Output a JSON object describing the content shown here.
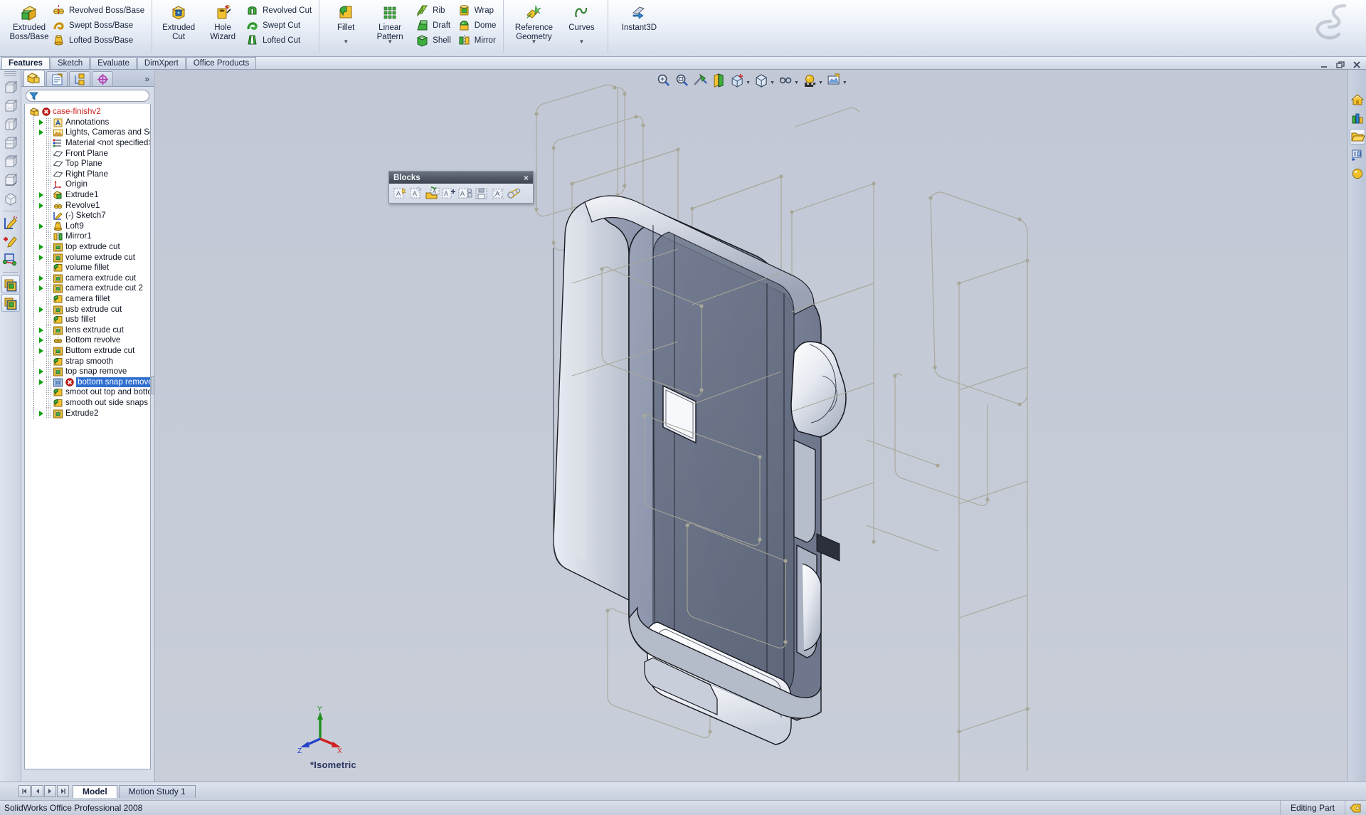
{
  "app": {
    "title": "SolidWorks Office Professional 2008",
    "status_right": "Editing Part"
  },
  "ribbon": {
    "groups": [
      {
        "big": {
          "label": "Extruded\nBoss/Base",
          "icon": "extruded-boss-base-icon"
        },
        "small": [
          {
            "label": "Revolved Boss/Base",
            "icon": "revolved-boss-base-icon"
          },
          {
            "label": "Swept Boss/Base",
            "icon": "swept-boss-base-icon"
          },
          {
            "label": "Lofted Boss/Base",
            "icon": "lofted-boss-base-icon"
          }
        ]
      },
      {
        "big2": [
          {
            "label": "Extruded\nCut",
            "icon": "extruded-cut-icon"
          },
          {
            "label": "Hole\nWizard",
            "icon": "hole-wizard-icon"
          }
        ],
        "small": [
          {
            "label": "Revolved Cut",
            "icon": "revolved-cut-icon"
          },
          {
            "label": "Swept Cut",
            "icon": "swept-cut-icon"
          },
          {
            "label": "Lofted Cut",
            "icon": "lofted-cut-icon"
          }
        ]
      },
      {
        "big2": [
          {
            "label": "Fillet",
            "icon": "fillet-icon"
          },
          {
            "label": "Linear\nPattern",
            "icon": "linear-pattern-icon"
          }
        ],
        "small": [
          {
            "label": "Rib",
            "icon": "rib-icon"
          },
          {
            "label": "Draft",
            "icon": "draft-icon"
          },
          {
            "label": "Shell",
            "icon": "shell-icon"
          }
        ],
        "small2": [
          {
            "label": "Wrap",
            "icon": "wrap-icon"
          },
          {
            "label": "Dome",
            "icon": "dome-icon"
          },
          {
            "label": "Mirror",
            "icon": "mirror-icon"
          }
        ]
      },
      {
        "big2": [
          {
            "label": "Reference\nGeometry",
            "icon": "reference-geometry-icon"
          },
          {
            "label": "Curves",
            "icon": "curves-icon"
          }
        ]
      },
      {
        "big2": [
          {
            "label": "Instant3D",
            "icon": "instant3d-icon"
          }
        ]
      }
    ]
  },
  "command_tabs": [
    {
      "label": "Features",
      "active": true
    },
    {
      "label": "Sketch",
      "active": false
    },
    {
      "label": "Evaluate",
      "active": false
    },
    {
      "label": "DimXpert",
      "active": false
    },
    {
      "label": "Office Products",
      "active": false
    }
  ],
  "feature_manager": {
    "tabs": [
      {
        "name": "feature-manager-design-tree-tab",
        "active": true
      },
      {
        "name": "property-manager-tab",
        "active": false
      },
      {
        "name": "configuration-manager-tab",
        "active": false
      },
      {
        "name": "dimxpert-manager-tab",
        "active": false
      }
    ],
    "more_label": "»",
    "filter_placeholder": "",
    "tree": [
      {
        "label": "case-finishv2",
        "icon": "part-icon",
        "indent": 0,
        "arrow": false,
        "root": true,
        "error": true
      },
      {
        "label": "Annotations",
        "icon": "annotations-icon",
        "indent": 1,
        "arrow": true
      },
      {
        "label": "Lights, Cameras and Scene",
        "icon": "lights-cameras-icon",
        "indent": 1,
        "arrow": true
      },
      {
        "label": "Material <not specified>",
        "icon": "material-icon",
        "indent": 1,
        "arrow": false
      },
      {
        "label": "Front Plane",
        "icon": "plane-icon",
        "indent": 1,
        "arrow": false
      },
      {
        "label": "Top Plane",
        "icon": "plane-icon",
        "indent": 1,
        "arrow": false
      },
      {
        "label": "Right Plane",
        "icon": "plane-icon",
        "indent": 1,
        "arrow": false
      },
      {
        "label": "Origin",
        "icon": "origin-icon",
        "indent": 1,
        "arrow": false
      },
      {
        "label": "Extrude1",
        "icon": "extrude-icon",
        "indent": 1,
        "arrow": true
      },
      {
        "label": "Revolve1",
        "icon": "revolve-icon",
        "indent": 1,
        "arrow": true
      },
      {
        "label": "(-) Sketch7",
        "icon": "sketch-icon",
        "indent": 1,
        "arrow": false
      },
      {
        "label": "Loft9",
        "icon": "loft-icon",
        "indent": 1,
        "arrow": true
      },
      {
        "label": "Mirror1",
        "icon": "mirror-feature-icon",
        "indent": 1,
        "arrow": false
      },
      {
        "label": "top extrude cut",
        "icon": "cut-extrude-icon",
        "indent": 1,
        "arrow": true
      },
      {
        "label": "volume extrude cut",
        "icon": "cut-extrude-icon",
        "indent": 1,
        "arrow": true
      },
      {
        "label": "volume fillet",
        "icon": "fillet-feature-icon",
        "indent": 1,
        "arrow": false
      },
      {
        "label": "camera extrude cut",
        "icon": "cut-extrude-icon",
        "indent": 1,
        "arrow": true
      },
      {
        "label": "camera extrude cut 2",
        "icon": "cut-extrude-icon",
        "indent": 1,
        "arrow": true
      },
      {
        "label": "camera fillet",
        "icon": "fillet-feature-icon",
        "indent": 1,
        "arrow": false
      },
      {
        "label": "usb extrude cut",
        "icon": "cut-extrude-icon",
        "indent": 1,
        "arrow": true
      },
      {
        "label": "usb fillet",
        "icon": "fillet-feature-icon",
        "indent": 1,
        "arrow": false
      },
      {
        "label": "lens extrude cut",
        "icon": "cut-extrude-icon",
        "indent": 1,
        "arrow": true
      },
      {
        "label": "Bottom revolve",
        "icon": "revolve-icon",
        "indent": 1,
        "arrow": true
      },
      {
        "label": "Buttom extrude cut",
        "icon": "cut-extrude-icon",
        "indent": 1,
        "arrow": true
      },
      {
        "label": "strap smooth",
        "icon": "fillet-feature-icon",
        "indent": 1,
        "arrow": false
      },
      {
        "label": "top snap remove",
        "icon": "cut-extrude-icon",
        "indent": 1,
        "arrow": true
      },
      {
        "label": "bottom snap remove",
        "icon": "cut-extrude-error-icon",
        "indent": 1,
        "arrow": true,
        "selected": true,
        "error": true
      },
      {
        "label": "smoot out top and bottom",
        "icon": "fillet-feature-icon",
        "indent": 1,
        "arrow": false
      },
      {
        "label": "smooth out side snaps",
        "icon": "fillet-feature-icon",
        "indent": 1,
        "arrow": false
      },
      {
        "label": "Extrude2",
        "icon": "cut-extrude-icon",
        "indent": 1,
        "arrow": true
      }
    ]
  },
  "blocks_toolbar": {
    "title": "Blocks",
    "close_label": "×",
    "buttons": [
      {
        "name": "make-block-icon"
      },
      {
        "name": "edit-block-icon"
      },
      {
        "name": "insert-block-icon"
      },
      {
        "name": "add-remove-entities-icon"
      },
      {
        "name": "rebuild-block-icon"
      },
      {
        "name": "save-block-icon"
      },
      {
        "name": "explode-block-icon"
      },
      {
        "name": "belt-chain-icon"
      }
    ]
  },
  "view_toolbar": [
    {
      "name": "zoom-to-fit-icon"
    },
    {
      "name": "zoom-to-area-icon"
    },
    {
      "name": "previous-view-icon"
    },
    {
      "name": "section-view-icon"
    },
    {
      "name": "view-orientation-icon",
      "caret": true
    },
    {
      "name": "display-style-icon",
      "caret": true
    },
    {
      "name": "hide-show-items-icon",
      "caret": true
    },
    {
      "name": "edit-appearance-icon",
      "caret": true
    },
    {
      "name": "apply-scene-icon",
      "caret": true
    }
  ],
  "left_rail": [
    {
      "name": "front-view-icon"
    },
    {
      "name": "back-view-icon"
    },
    {
      "name": "left-view-icon"
    },
    {
      "name": "right-view-icon"
    },
    {
      "name": "top-view-icon"
    },
    {
      "name": "bottom-view-icon"
    },
    {
      "name": "isometric-view-icon"
    },
    {
      "name": "sketch-tool-icon"
    },
    {
      "name": "add-sketch-icon"
    },
    {
      "name": "move-entity-icon"
    },
    {
      "name": "display-state-icon",
      "selected": true
    },
    {
      "name": "configuration-icon",
      "selected": true
    }
  ],
  "task_pane": [
    {
      "name": "solidworks-resources-icon",
      "on": false
    },
    {
      "name": "design-library-icon",
      "on": false
    },
    {
      "name": "file-explorer-icon",
      "on": true
    },
    {
      "name": "view-palette-icon",
      "on": false
    },
    {
      "name": "appearances-scenes-icon",
      "on": false
    }
  ],
  "viewport": {
    "orientation_label": "*Isometric",
    "triad": {
      "x": "X",
      "y": "Y",
      "z": "Z"
    },
    "model_name": "phone-case-3d-model"
  },
  "bottom_tabs": [
    {
      "label": "Model",
      "active": true
    },
    {
      "label": "Motion Study 1",
      "active": false
    }
  ],
  "nav_buttons": [
    {
      "name": "first-tab-button",
      "glyph": "⏮"
    },
    {
      "name": "prev-tab-button",
      "glyph": "◀"
    },
    {
      "name": "next-tab-button",
      "glyph": "▶"
    },
    {
      "name": "last-tab-button",
      "glyph": "⏭"
    }
  ],
  "mdi_controls": [
    {
      "name": "minimize-window-button"
    },
    {
      "name": "restore-window-button"
    },
    {
      "name": "close-window-button"
    }
  ],
  "colors": {
    "ribbon_bg": "#eef2f9",
    "viewport_bg": "#c5cbd7",
    "selection_blue": "#2f6fd0",
    "error_red": "#cf1f1f",
    "tree_text": "#101624"
  }
}
